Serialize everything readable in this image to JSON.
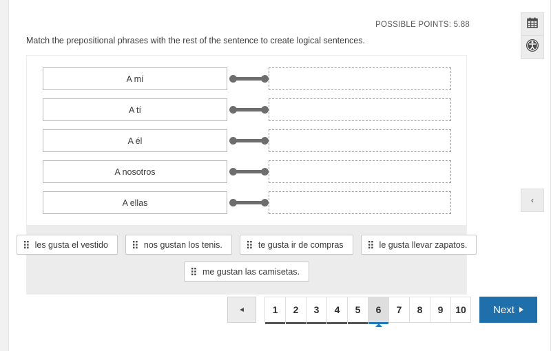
{
  "header": {
    "possible_points_label": "POSSIBLE POINTS: 5.88"
  },
  "question": {
    "prompt": "Match the prepositional phrases with the rest of the sentence to create logical sentences.",
    "match_rows": [
      {
        "prompt_text": "A mí",
        "drop_value": ""
      },
      {
        "prompt_text": "A tí",
        "drop_value": ""
      },
      {
        "prompt_text": "A él",
        "drop_value": ""
      },
      {
        "prompt_text": "A nosotros",
        "drop_value": ""
      },
      {
        "prompt_text": "A ellas",
        "drop_value": ""
      }
    ],
    "answer_bank": {
      "row1": [
        "les gusta el vestido",
        "nos gustan los tenis.",
        "te gusta ir de compras",
        "le gusta llevar zapatos."
      ],
      "row2": [
        "me gustan las camisetas."
      ]
    }
  },
  "pagination": {
    "prev_label": "◄",
    "pages": [
      {
        "label": "1",
        "state": "visited"
      },
      {
        "label": "2",
        "state": "visited"
      },
      {
        "label": "3",
        "state": "visited"
      },
      {
        "label": "4",
        "state": "visited"
      },
      {
        "label": "5",
        "state": "visited"
      },
      {
        "label": "6",
        "state": "active"
      },
      {
        "label": "7",
        "state": "default"
      },
      {
        "label": "8",
        "state": "default"
      },
      {
        "label": "9",
        "state": "default"
      },
      {
        "label": "10",
        "state": "default"
      }
    ],
    "next_label": "Next",
    "active_page": 6,
    "total_pages": 10
  },
  "toolbar": {
    "items": [
      {
        "icon": "calendar-icon"
      },
      {
        "icon": "accessibility-icon"
      }
    ],
    "collapse_label": "‹"
  },
  "colors": {
    "accent_blue": "#1f6fab",
    "active_underline": "#2079b8",
    "visited_underline": "#545454",
    "bank_background": "#ececec",
    "connector": "#6d6d6d"
  }
}
